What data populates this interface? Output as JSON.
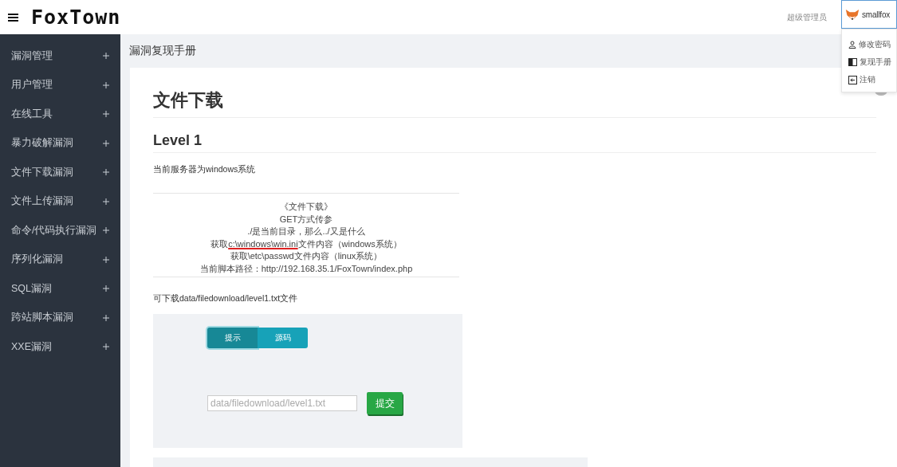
{
  "header": {
    "logo": "FoxTown",
    "role": "超级管理员",
    "user": "smallfox"
  },
  "user_menu": [
    {
      "kind": "person",
      "label": "修改密码"
    },
    {
      "kind": "book",
      "label": "复现手册"
    },
    {
      "kind": "logout",
      "label": "注销"
    }
  ],
  "sidebar": {
    "items": [
      {
        "label": "漏洞管理",
        "expanded": false
      },
      {
        "label": "用户管理",
        "expanded": false
      },
      {
        "label": "在线工具",
        "expanded": false
      },
      {
        "label": "暴力破解漏洞",
        "expanded": false
      },
      {
        "label": "文件下载漏洞",
        "expanded": false
      },
      {
        "label": "文件上传漏洞",
        "expanded": false
      },
      {
        "label": "命令/代码执行漏洞",
        "expanded": false
      },
      {
        "label": "序列化漏洞",
        "expanded": false
      },
      {
        "label": "SQL漏洞",
        "expanded": false
      },
      {
        "label": "跨站脚本漏洞",
        "expanded": false
      },
      {
        "label": "XXE漏洞",
        "expanded": false
      }
    ]
  },
  "breadcrumb": "漏洞复现手册",
  "page": {
    "title": "文件下载",
    "level_title": "Level 1",
    "intro": "当前服务器为windows系统",
    "hint_lines": [
      {
        "parts": [
          {
            "text": "《文件下载》",
            "underlined": false
          }
        ]
      },
      {
        "parts": [
          {
            "text": "GET方式传参",
            "underlined": false
          }
        ]
      },
      {
        "parts": [
          {
            "text": "./是当前目录，那么../又是什么",
            "underlined": false
          }
        ]
      },
      {
        "parts": [
          {
            "text": "获取",
            "underlined": false
          },
          {
            "text": "c:\\windows\\win.ini",
            "underlined": true
          },
          {
            "text": "文件内容（windows系统）",
            "underlined": false
          }
        ]
      },
      {
        "parts": [
          {
            "text": "获取\\etc\\passwd文件内容（linux系统）",
            "underlined": false
          }
        ]
      },
      {
        "parts": [
          {
            "text": "当前脚本路径：http://192.168.35.1/FoxTown/index.php",
            "underlined": false
          }
        ]
      }
    ],
    "note": "可下载data/filedownload/level1.txt文件",
    "tabs": [
      {
        "label": "提示",
        "selected": true
      },
      {
        "label": "源码",
        "selected": false
      }
    ],
    "input": {
      "placeholder": "data/filedownload/level1.txt"
    },
    "submit": "提交"
  }
}
